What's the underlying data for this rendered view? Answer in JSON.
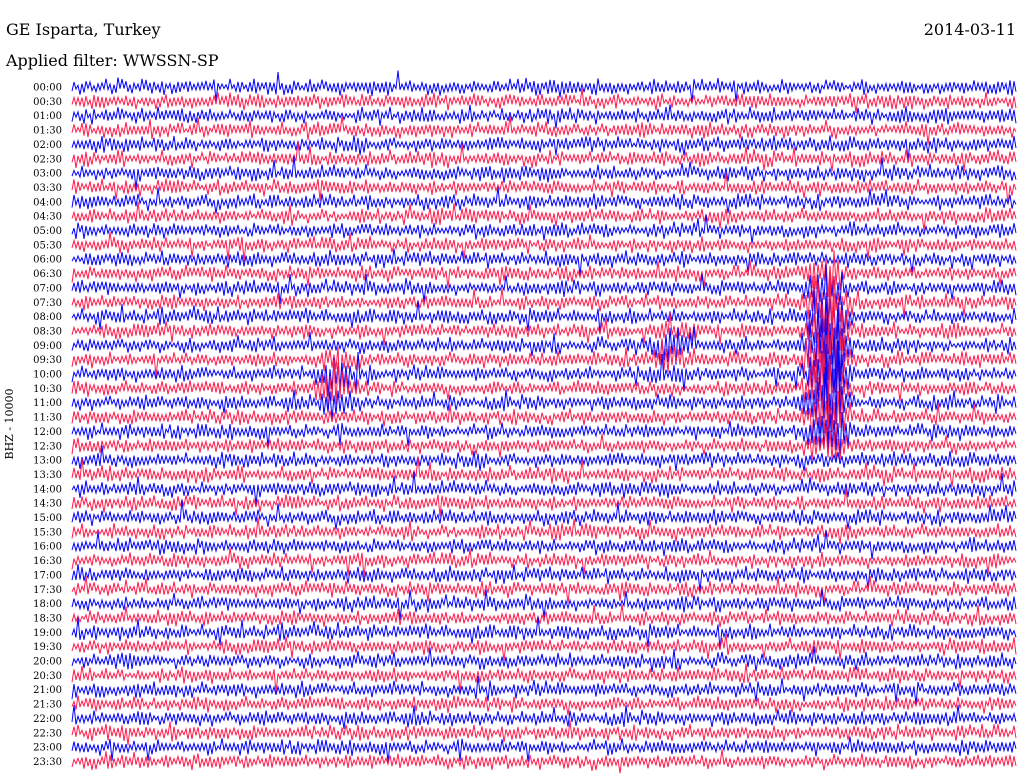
{
  "header": {
    "station": "GE Isparta, Turkey",
    "date": "2014-03-11",
    "filter": "Applied filter: WWSSN-SP"
  },
  "chart_data": {
    "type": "line",
    "title": "GE Isparta, Turkey",
    "subtitle": "Applied filter: WWSSN-SP",
    "ylabel": "BHZ - 10000",
    "xlabel": "",
    "row_labels": [
      "00:00",
      "00:30",
      "01:00",
      "01:30",
      "02:00",
      "02:30",
      "03:00",
      "03:30",
      "04:00",
      "04:30",
      "05:00",
      "05:30",
      "06:00",
      "06:30",
      "07:00",
      "07:30",
      "08:00",
      "08:30",
      "09:00",
      "09:30",
      "10:00",
      "10:30",
      "11:00",
      "11:30",
      "12:00",
      "12:30",
      "13:00",
      "13:30",
      "14:00",
      "14:30",
      "15:00",
      "15:30",
      "16:00",
      "16:30",
      "17:00",
      "17:30",
      "18:00",
      "18:30",
      "19:00",
      "19:30",
      "20:00",
      "20:30",
      "21:00",
      "21:30",
      "22:00",
      "22:30",
      "23:00",
      "23:30"
    ],
    "trace_colors": [
      "#0000ff",
      "#ff1a4a"
    ],
    "minutes_per_row": 30,
    "events": [
      {
        "row_start": "09:30",
        "row_end": "11:00",
        "minute": 8.4,
        "relative_amplitude": 2.2
      },
      {
        "row_start": "08:30",
        "row_end": "10:00",
        "minute": 19.0,
        "relative_amplitude": 1.6
      },
      {
        "row_start": "06:30",
        "row_end": "12:30",
        "minute": 24.0,
        "relative_amplitude": 5.5
      }
    ],
    "grid": false,
    "legend": "none"
  }
}
